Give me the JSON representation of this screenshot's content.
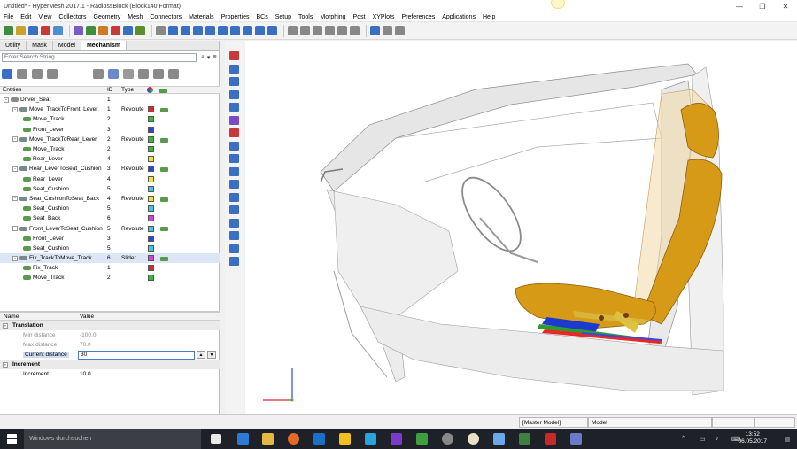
{
  "window": {
    "title": "Untitled* - HyperMesh 2017.1 - RadiossBlock (Block140 Format)",
    "controls": [
      "—",
      "❐",
      "✕"
    ]
  },
  "menu": [
    "File",
    "Edit",
    "View",
    "Collectors",
    "Geometry",
    "Mesh",
    "Connectors",
    "Materials",
    "Properties",
    "BCs",
    "Setup",
    "Tools",
    "Morphing",
    "Post",
    "XYPlots",
    "Preferences",
    "Applications",
    "Help"
  ],
  "tabs": [
    {
      "label": "Utility"
    },
    {
      "label": "Mask"
    },
    {
      "label": "Model"
    },
    {
      "label": "Mechanism",
      "active": true
    }
  ],
  "search": {
    "placeholder": "Enter Search String..."
  },
  "entities": {
    "headers": {
      "entities": "Entities",
      "id": "ID",
      "type": "Type"
    },
    "rows": [
      {
        "level": 0,
        "expander": "-",
        "name": "Driver_Seat",
        "id": "1",
        "type": "",
        "color": "",
        "lock": false,
        "icon": "seat"
      },
      {
        "level": 1,
        "expander": "-",
        "name": "Move_TrackToFront_Lever",
        "id": "1",
        "type": "Revolute",
        "color": "#d82a2a",
        "lock": true,
        "icon": "joint"
      },
      {
        "level": 2,
        "expander": "",
        "name": "Move_Track",
        "id": "2",
        "type": "",
        "color": "#39b93a",
        "lock": false,
        "icon": "body"
      },
      {
        "level": 2,
        "expander": "",
        "name": "Front_Lever",
        "id": "3",
        "type": "",
        "color": "#2c47d6",
        "lock": false,
        "icon": "body"
      },
      {
        "level": 1,
        "expander": "-",
        "name": "Move_TrackToRear_Lever",
        "id": "2",
        "type": "Revolute",
        "color": "#39b93a",
        "lock": true,
        "icon": "joint"
      },
      {
        "level": 2,
        "expander": "",
        "name": "Move_Track",
        "id": "2",
        "type": "",
        "color": "#39b93a",
        "lock": false,
        "icon": "body"
      },
      {
        "level": 2,
        "expander": "",
        "name": "Rear_Lever",
        "id": "4",
        "type": "",
        "color": "#f0e234",
        "lock": false,
        "icon": "body"
      },
      {
        "level": 1,
        "expander": "-",
        "name": "Rear_LeverToSeat_Cushion",
        "id": "3",
        "type": "Revolute",
        "color": "#2c47d6",
        "lock": true,
        "icon": "joint"
      },
      {
        "level": 2,
        "expander": "",
        "name": "Rear_Lever",
        "id": "4",
        "type": "",
        "color": "#f0e234",
        "lock": false,
        "icon": "body"
      },
      {
        "level": 2,
        "expander": "",
        "name": "Seat_Cushion",
        "id": "5",
        "type": "",
        "color": "#3cc6e8",
        "lock": false,
        "icon": "body"
      },
      {
        "level": 1,
        "expander": "-",
        "name": "Seat_CushionToSeat_Back",
        "id": "4",
        "type": "Revolute",
        "color": "#f0e234",
        "lock": true,
        "icon": "joint"
      },
      {
        "level": 2,
        "expander": "",
        "name": "Seat_Cushion",
        "id": "5",
        "type": "",
        "color": "#3cc6e8",
        "lock": false,
        "icon": "body"
      },
      {
        "level": 2,
        "expander": "",
        "name": "Seat_Back",
        "id": "6",
        "type": "",
        "color": "#d640d6",
        "lock": false,
        "icon": "body"
      },
      {
        "level": 1,
        "expander": "-",
        "name": "Front_LeverToSeat_Cushion",
        "id": "5",
        "type": "Revolute",
        "color": "#3cc6e8",
        "lock": true,
        "icon": "joint"
      },
      {
        "level": 2,
        "expander": "",
        "name": "Front_Lever",
        "id": "3",
        "type": "",
        "color": "#2c47d6",
        "lock": false,
        "icon": "body"
      },
      {
        "level": 2,
        "expander": "",
        "name": "Seat_Cushion",
        "id": "5",
        "type": "",
        "color": "#3cc6e8",
        "lock": false,
        "icon": "body"
      },
      {
        "level": 1,
        "expander": "-",
        "name": "Fix_TrackToMove_Track",
        "id": "6",
        "type": "Slider",
        "color": "#d640d6",
        "lock": true,
        "icon": "joint",
        "selected": true
      },
      {
        "level": 2,
        "expander": "",
        "name": "Fix_Track",
        "id": "1",
        "type": "",
        "color": "#d82a2a",
        "lock": false,
        "icon": "body"
      },
      {
        "level": 2,
        "expander": "",
        "name": "Move_Track",
        "id": "2",
        "type": "",
        "color": "#39b93a",
        "lock": false,
        "icon": "body"
      }
    ]
  },
  "properties": {
    "headers": {
      "name": "Name",
      "value": "Value"
    },
    "groups": [
      {
        "title": "Translation",
        "items": [
          {
            "name": "Min distance",
            "value": "-100.0",
            "disabled": true
          },
          {
            "name": "Max distance",
            "value": "70.0",
            "disabled": true
          },
          {
            "name": "Current distance",
            "value": "30",
            "editing": true
          }
        ]
      },
      {
        "title": "Increment",
        "items": [
          {
            "name": "Increment",
            "value": "10.0"
          }
        ]
      }
    ]
  },
  "status": {
    "model_tag": "Master Model",
    "model_label": "Model"
  },
  "taskbar": {
    "search_placeholder": "Windows durchsuchen",
    "time": "13:52",
    "date": "06.05.2017"
  },
  "colors": {
    "seat": "#d69a16",
    "body_wire": "#9a9a9a",
    "selected_row": "#dde6f5",
    "taskbar": "#1e2228"
  }
}
